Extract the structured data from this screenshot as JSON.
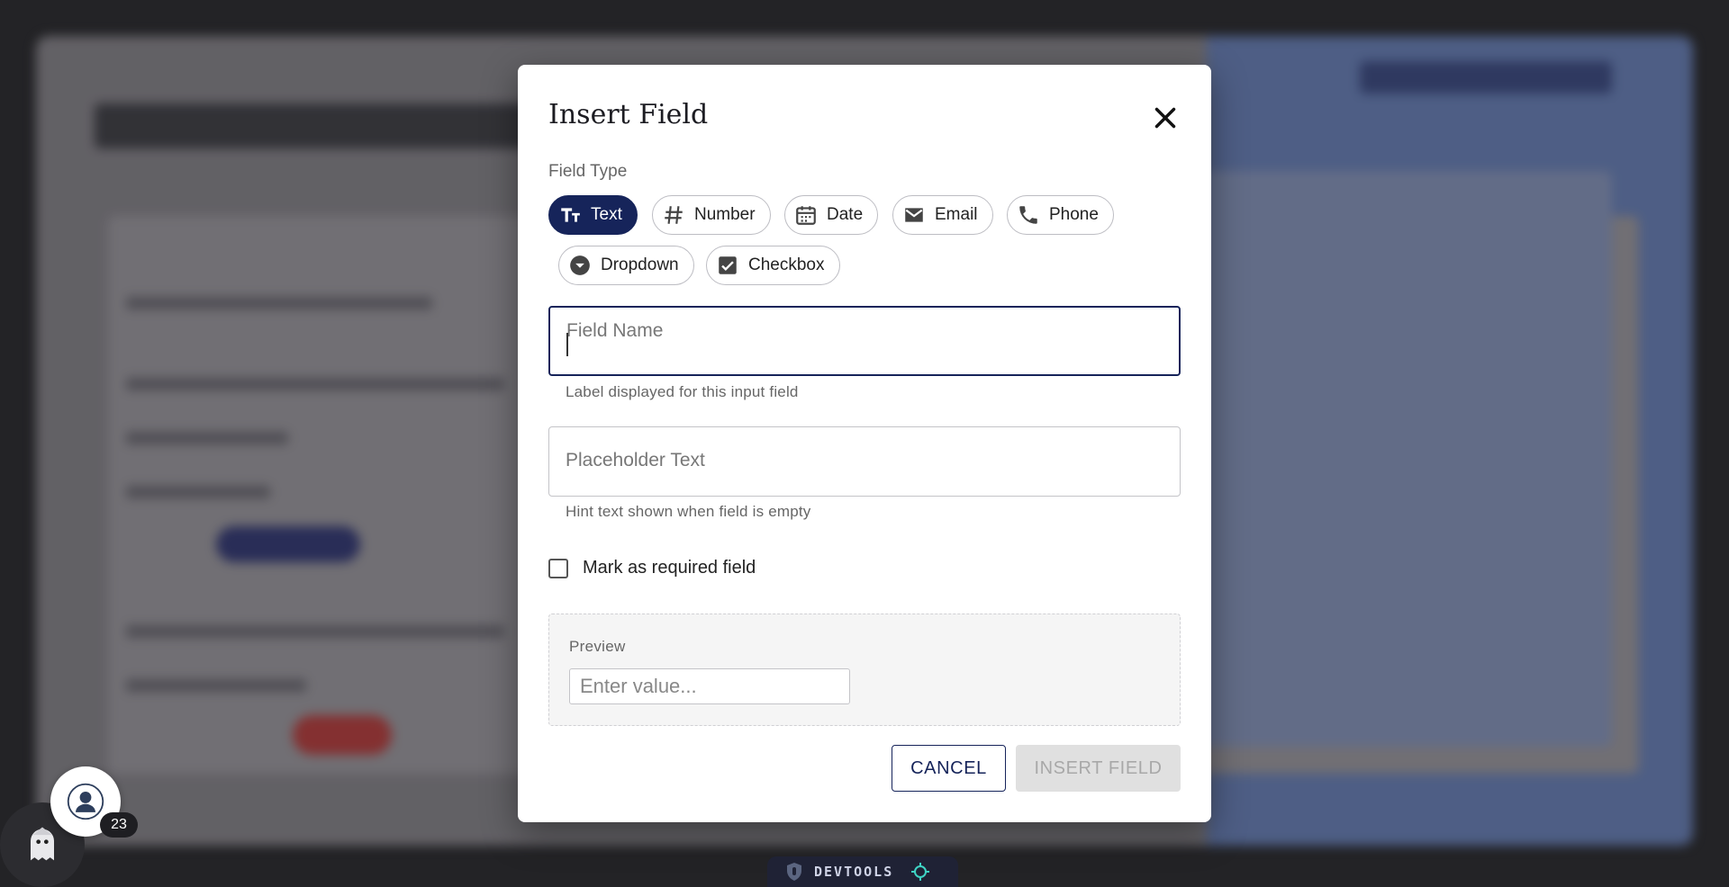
{
  "dialog": {
    "title": "Insert Field",
    "field_type_label": "Field Type",
    "field_types": [
      {
        "label": "Text",
        "icon": "text-format-icon",
        "selected": true
      },
      {
        "label": "Number",
        "icon": "hash-icon",
        "selected": false
      },
      {
        "label": "Date",
        "icon": "calendar-icon",
        "selected": false
      },
      {
        "label": "Email",
        "icon": "mail-icon",
        "selected": false
      },
      {
        "label": "Phone",
        "icon": "phone-icon",
        "selected": false
      },
      {
        "label": "Dropdown",
        "icon": "dropdown-circle-icon",
        "selected": false
      },
      {
        "label": "Checkbox",
        "icon": "checkbox-checked-icon",
        "selected": false
      }
    ],
    "field_name": {
      "label": "Field Name",
      "value": "",
      "helper": "Label displayed for this input field"
    },
    "placeholder_text": {
      "label": "Placeholder Text",
      "value": "",
      "helper": "Hint text shown when field is empty"
    },
    "required": {
      "label": "Mark as required field",
      "checked": false
    },
    "preview": {
      "label": "Preview",
      "input_placeholder": "Enter value..."
    },
    "cancel_label": "CANCEL",
    "insert_label": "INSERT FIELD"
  },
  "widgets": {
    "notification_count": "23",
    "devtools_label": "DEVTOOLS"
  },
  "colors": {
    "primary": "#16245a",
    "disabled_bg": "#e0e0e0",
    "disabled_text": "#a8a8a8"
  }
}
